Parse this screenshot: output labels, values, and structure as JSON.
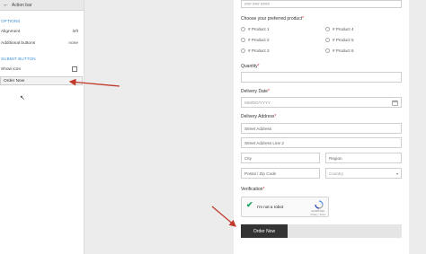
{
  "panel": {
    "title": "Action bar",
    "sections": {
      "options": "OPTIONS",
      "submit": "SUBMIT BUTTON"
    },
    "rows": {
      "alignment_label": "Alignment",
      "alignment_value": "left",
      "additional_label": "Additional buttons",
      "additional_value": "none",
      "show_icon_label": "Show icon"
    },
    "button_text_value": "Order Now"
  },
  "form": {
    "phone_placeholder": "### ### ####",
    "product_label": "Choose your preferred product",
    "products": [
      "# Product 1",
      "# Product 2",
      "# Product 3",
      "# Product 4",
      "# Product 5",
      "# Product 6"
    ],
    "quantity_label": "Quantity",
    "delivery_date_label": "Delivery Date",
    "date_placeholder": "MM/DD/YYYY",
    "delivery_address_label": "Delivery Address",
    "street_placeholder": "Street Address",
    "street2_placeholder": "Street Address Line 2",
    "city_placeholder": "City",
    "region_placeholder": "Region",
    "postal_placeholder": "Postal / Zip Code",
    "country_placeholder": "Country",
    "verification_label": "Verification",
    "captcha_text": "I'm not a robot",
    "captcha_brand": "reCAPTCHA",
    "captcha_terms": "Privacy - Terms",
    "order_button": "Order Now",
    "required_mark": "*"
  },
  "colors": {
    "accent": "#3a8fd6",
    "arrow": "#c0392b",
    "button": "#333333"
  }
}
